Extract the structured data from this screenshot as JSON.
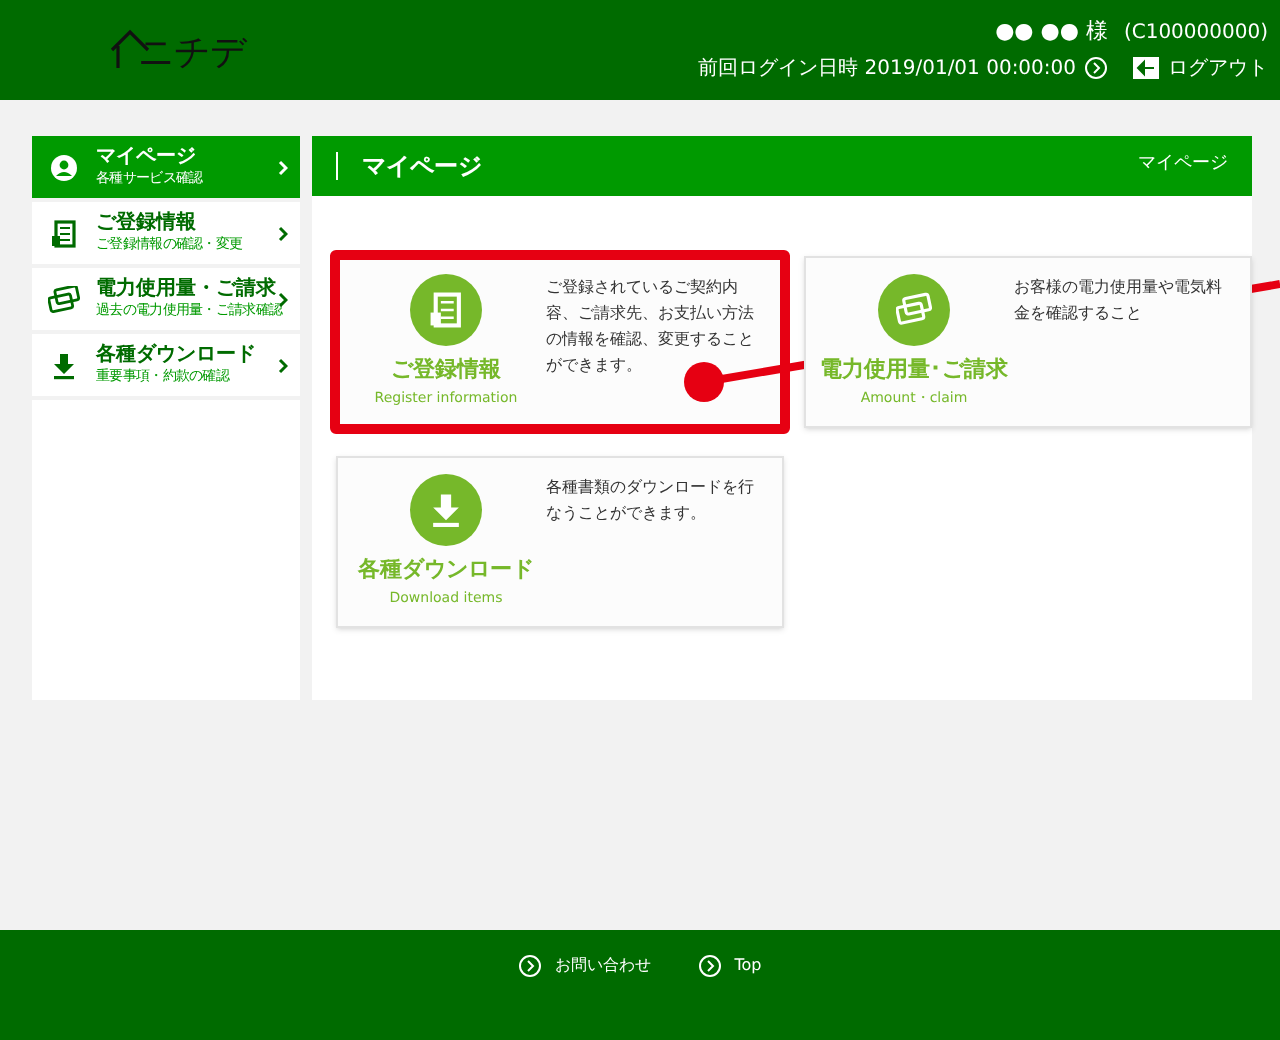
{
  "header": {
    "logo": "ニチデ",
    "user_name": "●● ●● 様",
    "customer_id": "(C100000000)",
    "last_login": "前回ログイン日時 2019/01/01 00:00:00",
    "logout": "ログアウト"
  },
  "sidebar": {
    "items": [
      {
        "title": "マイページ",
        "subtitle": "各種サービス確認",
        "kind": "user",
        "selected": true
      },
      {
        "title": "ご登録情報",
        "subtitle": "ご登録情報の確認・変更",
        "kind": "document",
        "selected": false
      },
      {
        "title": "電力使用量・ご請求",
        "subtitle": "過去の電力使用量・ご請求確認",
        "kind": "card",
        "selected": false
      },
      {
        "title": "各種ダウンロード",
        "subtitle": "重要事項・約款の確認",
        "kind": "download",
        "selected": false
      }
    ]
  },
  "main": {
    "title": "マイページ",
    "breadcrumb": "マイページ",
    "cards": [
      {
        "title": "ご登録情報",
        "subtitle": "Register information",
        "description": "ご登録されているご契約内容、ご請求先、お支払い方法の情報を確認、変更することができます。",
        "kind": "document",
        "highlighted": true
      },
      {
        "title": "電力使用量･ご請求",
        "subtitle": "Amount・claim",
        "description": "お客様の電力使用量や電気料金を確認すること",
        "kind": "card",
        "highlighted": false
      },
      {
        "title": "各種ダウンロード",
        "subtitle": "Download items",
        "description": "各種書類のダウンロードを行なうことができます。",
        "kind": "download",
        "highlighted": false
      }
    ]
  },
  "annotation": {
    "kind": "callout"
  },
  "footer": {
    "links": [
      "お問い合わせ",
      "Top"
    ]
  }
}
